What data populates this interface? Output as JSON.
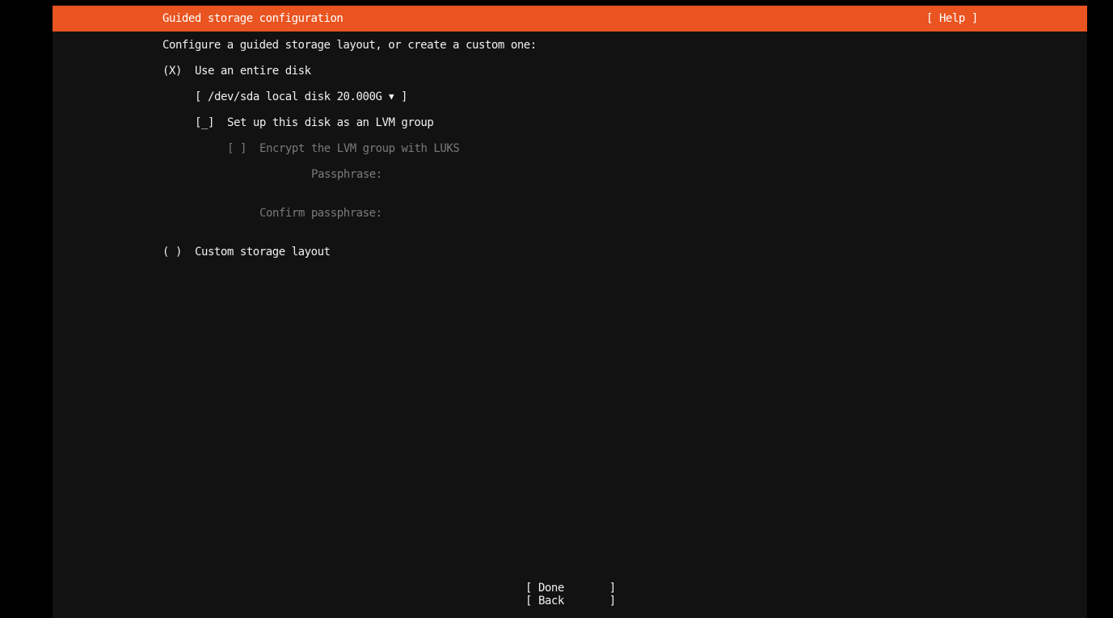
{
  "header": {
    "title": "Guided storage configuration",
    "help_label": "[ Help ]",
    "accent_color": "#e95420"
  },
  "main": {
    "intro": "Configure a guided storage layout, or create a custom one:",
    "entire_disk_option": {
      "radio": "(X)",
      "label": "Use an entire disk",
      "selected": true
    },
    "disk_select": {
      "open_bracket": "[",
      "value": "/dev/sda local disk 20.000G",
      "arrow": "▼",
      "close_bracket": "]"
    },
    "lvm_checkbox": {
      "box": "[_]",
      "label": "Set up this disk as an LVM group",
      "checked": false
    },
    "encrypt_checkbox": {
      "box": "[ ]",
      "label": "Encrypt the LVM group with LUKS",
      "disabled": true
    },
    "passphrase_label": "Passphrase:",
    "confirm_passphrase_label": "Confirm passphrase:",
    "custom_option": {
      "radio": "( )",
      "label": "Custom storage layout",
      "selected": false
    }
  },
  "footer": {
    "done_label": "[ Done       ]",
    "back_label": "[ Back       ]"
  }
}
